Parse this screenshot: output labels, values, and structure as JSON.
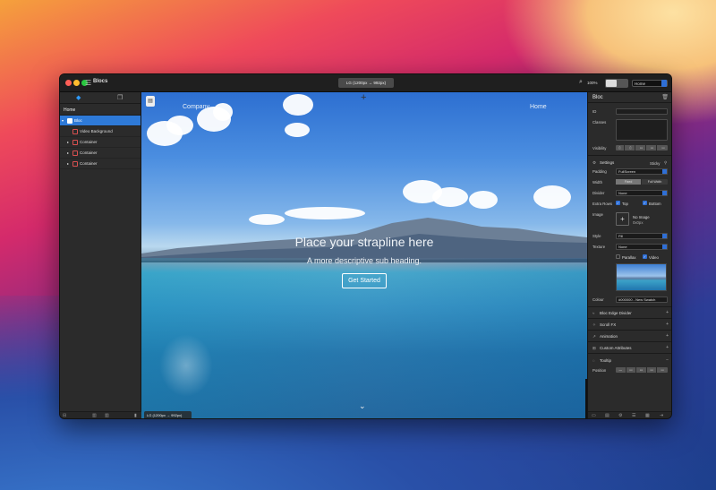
{
  "app": {
    "title": "Blocs"
  },
  "toolbar": {
    "device_label": "LG (1200px → 992px)",
    "zoom": "100%",
    "page_select": "Home"
  },
  "left_panel": {
    "page": "Home",
    "tree": [
      {
        "label": "Bloc",
        "selected": true
      },
      {
        "label": "Video Background",
        "selected": false
      },
      {
        "label": "Container",
        "selected": false
      },
      {
        "label": "Container",
        "selected": false
      },
      {
        "label": "Container",
        "selected": false
      }
    ]
  },
  "canvas": {
    "nav_left": "Company",
    "nav_right": "Home",
    "strapline": "Place your strapline here",
    "subheading": "A more descriptive sub heading.",
    "cta": "Get Started",
    "device_label": "LG (1200px → 992px)"
  },
  "right_panel": {
    "title": "Bloc",
    "id_label": "ID",
    "classes_label": "Classes",
    "visibility_label": "Visibility",
    "settings_label": "Settings",
    "sticky_label": "Sticky",
    "padding_label": "Padding",
    "padding_value": "FullScreen",
    "width_label": "Width",
    "width_options": [
      "Fixed",
      "Full Width"
    ],
    "divider_label": "Divider",
    "divider_value": "None",
    "extra_rows_label": "Extra Rows",
    "extra_top": "Top",
    "extra_bottom": "Bottom",
    "image_label": "Image",
    "no_image": "No Image",
    "no_image_size": "0x0px",
    "style_label": "Style",
    "style_value": "Fill",
    "texture_label": "Texture",
    "texture_value": "None",
    "parallax_label": "Parallax",
    "video_label": "Video",
    "colour_label": "Colour",
    "colour_value": "#000000 - New Swatch",
    "sections": [
      "Bloc Edge Divider",
      "Scroll FX",
      "Animation",
      "Custom Attributes",
      "Tooltip"
    ],
    "position_label": "Position"
  },
  "colors": {
    "accent": "#2e7ad8",
    "panel": "#2b2b2b"
  }
}
